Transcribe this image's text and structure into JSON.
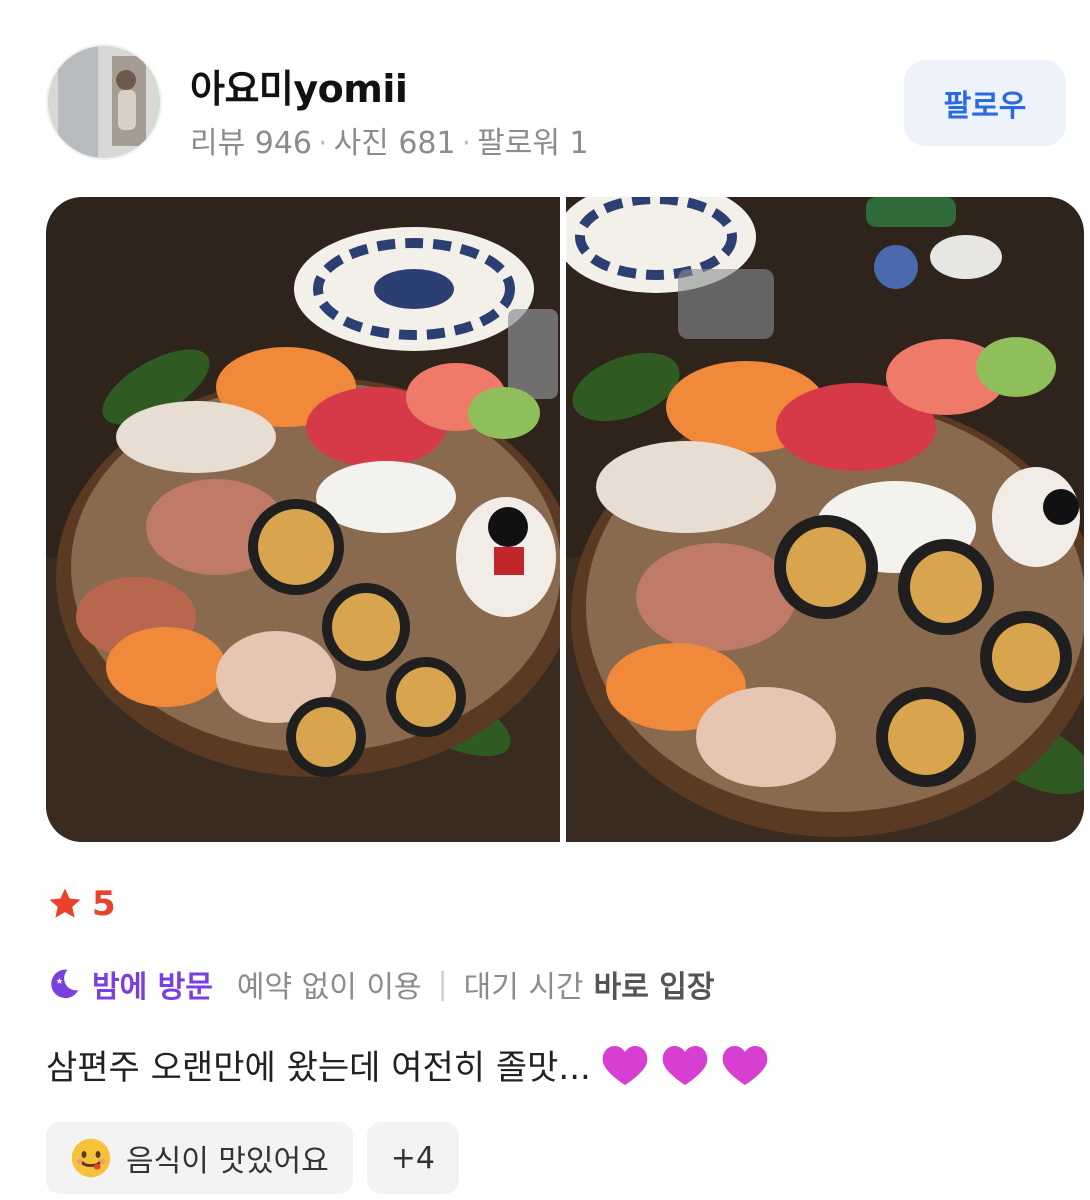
{
  "profile": {
    "name": "아요미yomii",
    "stats": [
      {
        "label": "리뷰",
        "value": "946"
      },
      {
        "label": "사진",
        "value": "681"
      },
      {
        "label": "팔로워",
        "value": "1"
      }
    ],
    "follow_label": "팔로우"
  },
  "rating": {
    "value": "5",
    "icon": "star-icon",
    "color": "#e8432a"
  },
  "visit": {
    "time_icon": "moon-icon",
    "time": "밤에 방문",
    "reservation": {
      "value": "예약 없이 이용"
    },
    "wait": {
      "key": "대기 시간",
      "value": "바로 입장"
    }
  },
  "review": {
    "text": "삼편주 오랜만에 왔는데 여전히 졸맛...",
    "emoji": "purple-heart-icon",
    "emoji_count": 3
  },
  "tags": [
    {
      "icon": "smiling-face-icon",
      "label": "음식이 맛있어요"
    },
    {
      "label": "+4"
    }
  ],
  "colors": {
    "accent_blue": "#2a6ae0",
    "follow_bg": "#eef2fa",
    "purple": "#7a3fe0",
    "heart": "#d63fd0"
  }
}
